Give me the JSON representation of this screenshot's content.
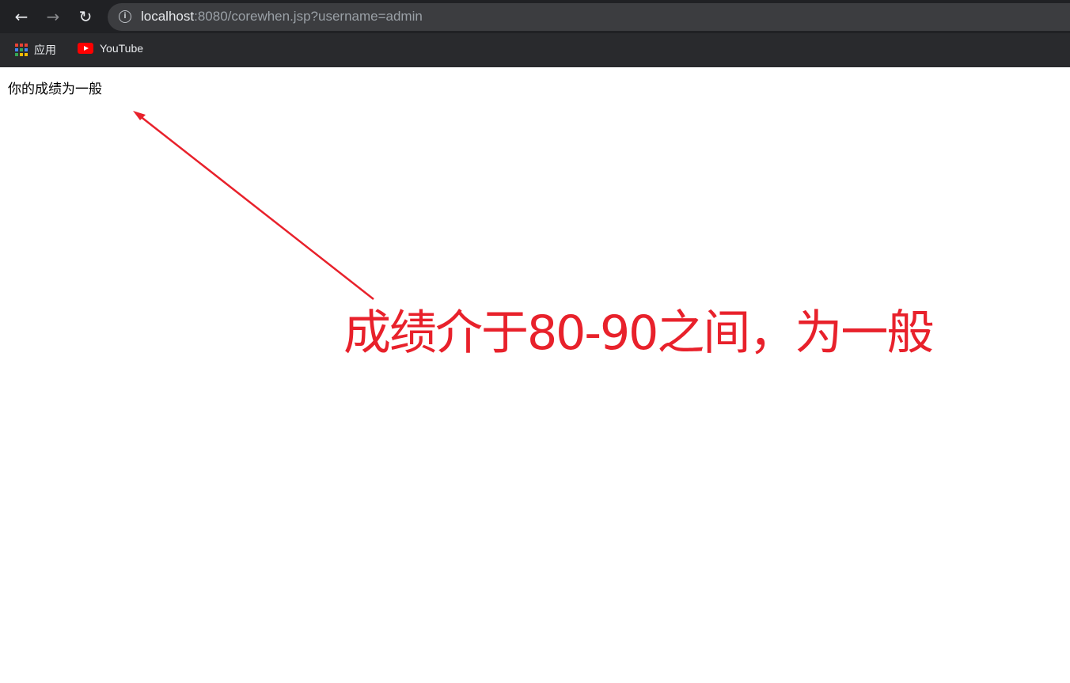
{
  "browser": {
    "url_host": "localhost",
    "url_rest": ":8080/corewhen.jsp?username=admin",
    "bookmarks": [
      {
        "label": "应用",
        "icon": "apps-grid-icon"
      },
      {
        "label": "YouTube",
        "icon": "youtube-icon"
      }
    ]
  },
  "page": {
    "message": "你的成绩为一般"
  },
  "annotation": {
    "text": "成绩介于80-90之间，为一般",
    "color": "#e8212b"
  }
}
